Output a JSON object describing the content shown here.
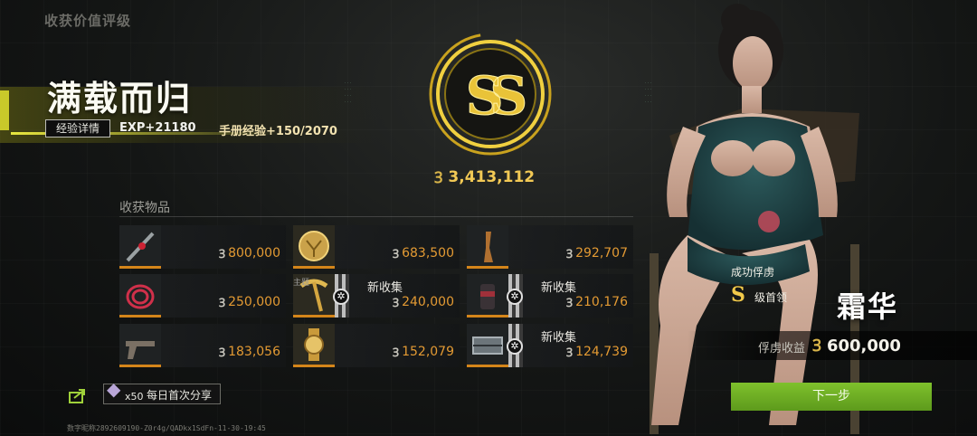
{
  "page_title": "收获价值评级",
  "result": {
    "title": "满载而归",
    "exp_detail_label": "经验详情",
    "exp_gain": "EXP+21180",
    "handbook_exp": "手册经验+150/2070"
  },
  "rank": {
    "grade": "SS",
    "total_value": "3,413,112"
  },
  "items_section_label": "收获物品",
  "items": [
    {
      "icon": "rifle-scope-icon",
      "value": "800,000",
      "new": "",
      "owner": ""
    },
    {
      "icon": "gold-medallion-icon",
      "value": "683,500",
      "new": "",
      "owner": ""
    },
    {
      "icon": "figurine-icon",
      "value": "292,707",
      "new": "",
      "owner": ""
    },
    {
      "icon": "red-rope-icon",
      "value": "250,000",
      "new": "",
      "owner": ""
    },
    {
      "icon": "gold-pickaxe-icon",
      "value": "240,000",
      "new": "新收集",
      "owner": "主题"
    },
    {
      "icon": "canister-icon",
      "value": "210,176",
      "new": "新收集",
      "owner": ""
    },
    {
      "icon": "pistol-icon",
      "value": "183,056",
      "new": "",
      "owner": ""
    },
    {
      "icon": "gold-watch-icon",
      "value": "152,079",
      "new": "",
      "owner": ""
    },
    {
      "icon": "crate-icon",
      "value": "124,739",
      "new": "新收集",
      "owner": ""
    }
  ],
  "share": {
    "count": "x50",
    "label": "每日首次分享"
  },
  "footer_id": "数字昵称2892609190-Z0r4g/QADkx1SdFn-11-30-19:45",
  "captive": {
    "status": "成功俘虏",
    "rank_letter": "S",
    "rank_label": "级首领",
    "name": "霜华",
    "income_label": "俘虏收益",
    "income_value": "600,000"
  },
  "next_button": "下一步",
  "coin_symbol": "Ꝫ",
  "colors": {
    "accent_gold": "#f1c94a",
    "value_orange": "#e39a33",
    "banner_yellow": "#c9c92a",
    "button_green": "#6faf24"
  }
}
